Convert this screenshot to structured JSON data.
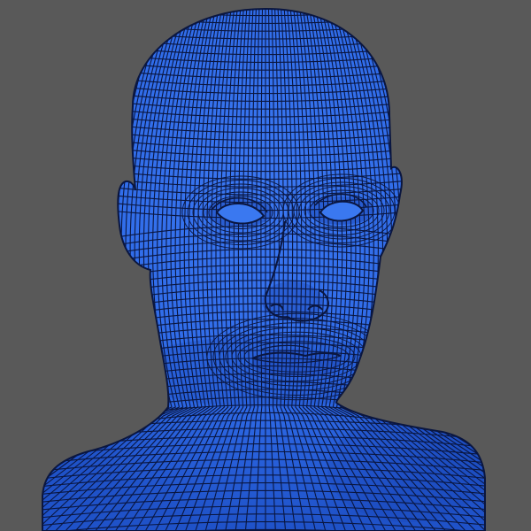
{
  "viewport": {
    "background_color": "#595959",
    "subject": "head-bust-wireframe"
  },
  "mesh": {
    "fill_color": "#2f6be8",
    "shade_color": "#1e4fc4",
    "highlight_color": "#4a86ff",
    "wire_color": "#0a1640"
  }
}
